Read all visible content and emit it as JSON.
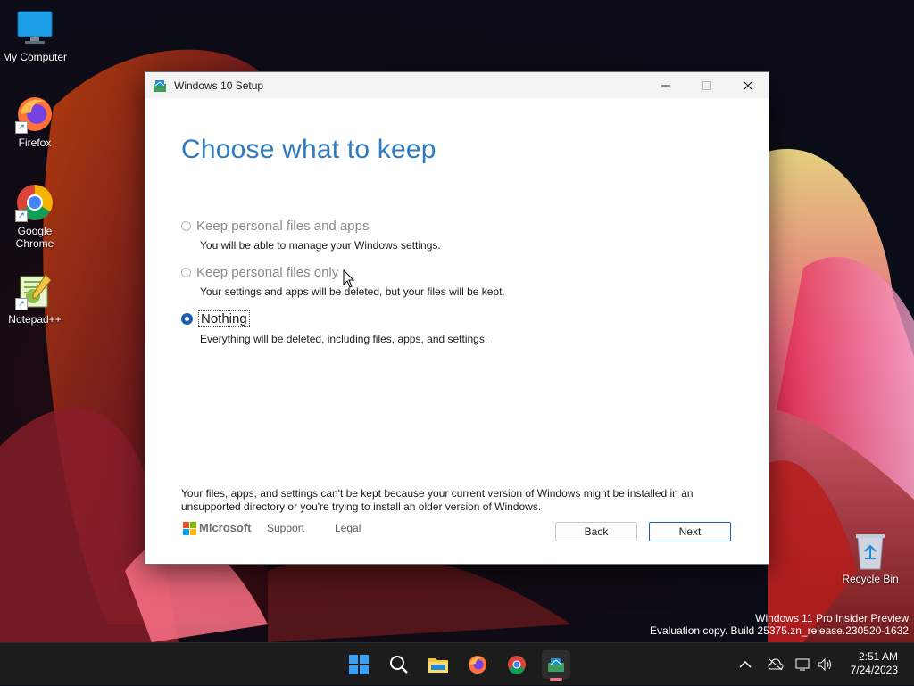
{
  "desktop": {
    "icons": [
      {
        "label": "My Computer"
      },
      {
        "label": "Firefox"
      },
      {
        "label": "Google Chrome"
      },
      {
        "label": "Notepad++"
      }
    ],
    "recycle_bin": "Recycle Bin",
    "watermark": {
      "line1": "Windows 11 Pro Insider Preview",
      "line2": "Evaluation copy. Build 25375.zn_release.230520-1632"
    }
  },
  "window": {
    "title": "Windows 10 Setup",
    "heading": "Choose what to keep",
    "options": [
      {
        "label": "Keep personal files and apps",
        "desc": "You will be able to manage your Windows settings.",
        "selected": false,
        "enabled": false
      },
      {
        "label": "Keep personal files only",
        "desc": "Your settings and apps will be deleted, but your files will be kept.",
        "selected": false,
        "enabled": false
      },
      {
        "label": "Nothing",
        "desc": "Everything will be deleted, including files, apps, and settings.",
        "selected": true,
        "enabled": true
      }
    ],
    "footnote": "Your files, apps, and settings can't be kept because your current version of Windows might be installed in an unsupported directory or you're trying to install an older version of Windows.",
    "brand": "Microsoft",
    "links": {
      "support": "Support",
      "legal": "Legal"
    },
    "buttons": {
      "back": "Back",
      "next": "Next"
    }
  },
  "taskbar": {
    "clock": {
      "time": "2:51 AM",
      "date": "7/24/2023"
    }
  },
  "colors": {
    "accent": "#1a5fb4",
    "heading": "#2f7bbf"
  }
}
